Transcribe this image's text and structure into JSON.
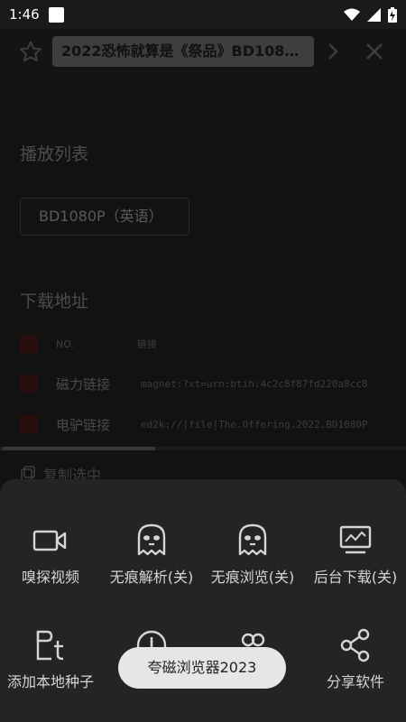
{
  "status_bar": {
    "time": "1:46"
  },
  "title_bar": {
    "title": "2022恐怖就算是《祭品》BD1080..."
  },
  "page": {
    "playlist_title": "播放列表",
    "playlist_item": "BD1080P（英语）",
    "download_title": "下载地址",
    "table_header": {
      "no": "NO.",
      "link": "链接"
    },
    "rows": [
      {
        "name": "磁力链接",
        "link": "magnet:?xt=urn:btih:4c2c8f87fd220a8cc8"
      },
      {
        "name": "电驴链接",
        "link": "ed2k://|file|The.Offering.2022.BD1080P"
      }
    ],
    "copy_label": "复制选中"
  },
  "sheet": {
    "items": [
      {
        "label": "嗅探视频",
        "icon": "video-camera-icon"
      },
      {
        "label": "无痕解析(关)",
        "icon": "ghost-icon"
      },
      {
        "label": "无痕浏览(关)",
        "icon": "ghost-icon"
      },
      {
        "label": "后台下载(关)",
        "icon": "monitor-chart-icon"
      },
      {
        "label": "添加本地种子",
        "icon": "seed-file-icon"
      },
      {
        "label": "",
        "icon": "info-icon"
      },
      {
        "label": "",
        "icon": "users-icon"
      },
      {
        "label": "分享软件",
        "icon": "share-icon"
      }
    ]
  },
  "toast": {
    "text": "夸磁浏览器2023"
  }
}
